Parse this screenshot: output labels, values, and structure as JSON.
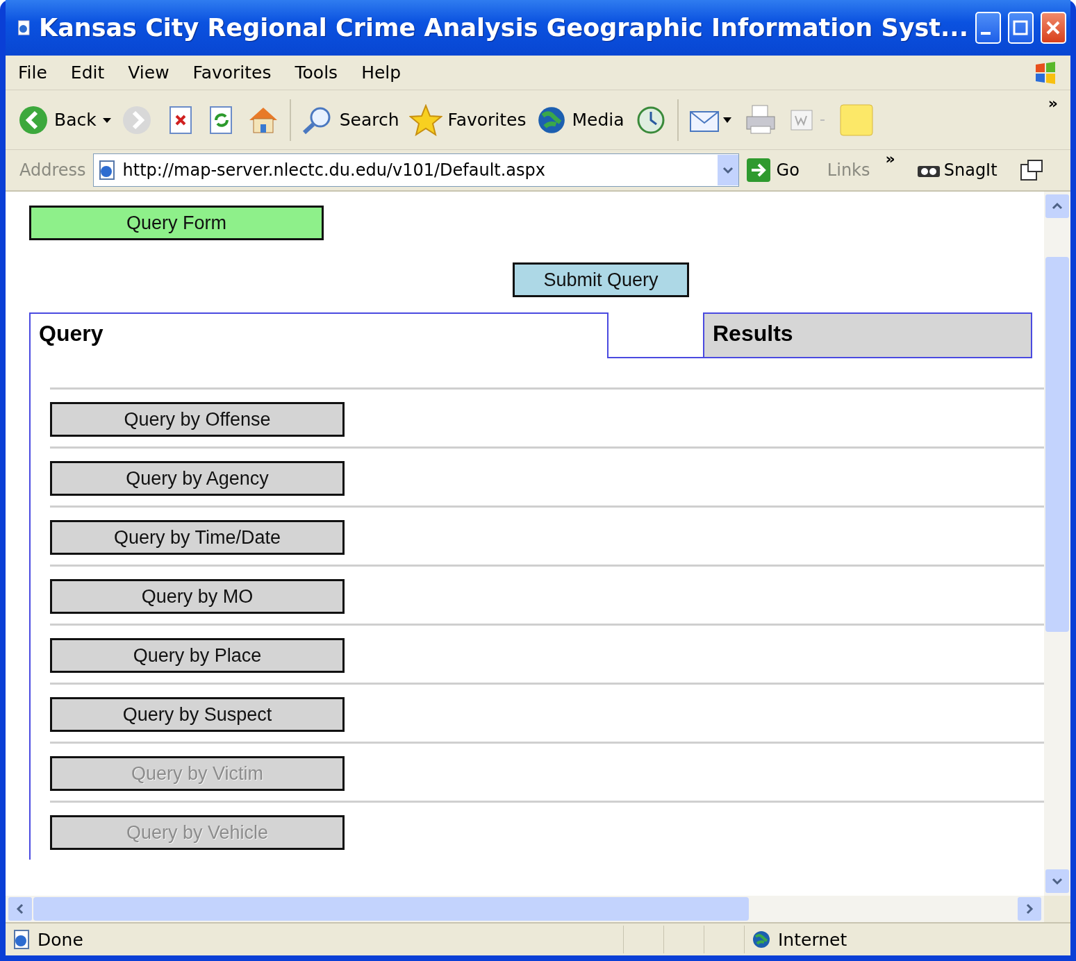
{
  "window": {
    "title": "Kansas City Regional Crime Analysis Geographic Information Syst..."
  },
  "menu": [
    "File",
    "Edit",
    "View",
    "Favorites",
    "Tools",
    "Help"
  ],
  "toolbar": {
    "back": "Back",
    "search": "Search",
    "favorites": "Favorites",
    "media": "Media",
    "more": "»"
  },
  "address_bar": {
    "label": "Address",
    "url": "http://map-server.nlectc.du.edu/v101/Default.aspx",
    "go": "Go",
    "links": "Links",
    "links_more": "»",
    "snagit": "SnagIt"
  },
  "page": {
    "query_form_button": "Query Form",
    "submit_button": "Submit Query",
    "tabs": [
      {
        "label": "Query",
        "selected": true
      },
      {
        "label": "Results",
        "selected": false
      }
    ],
    "query_buttons": [
      {
        "label": "Query by Offense",
        "disabled": false
      },
      {
        "label": "Query by Agency",
        "disabled": false
      },
      {
        "label": "Query by Time/Date",
        "disabled": false
      },
      {
        "label": "Query by MO",
        "disabled": false
      },
      {
        "label": "Query by Place",
        "disabled": false
      },
      {
        "label": "Query by Suspect",
        "disabled": false
      },
      {
        "label": "Query by Victim",
        "disabled": true
      },
      {
        "label": "Query by Vehicle",
        "disabled": true
      }
    ]
  },
  "status_bar": {
    "status": "Done",
    "zone": "Internet"
  }
}
